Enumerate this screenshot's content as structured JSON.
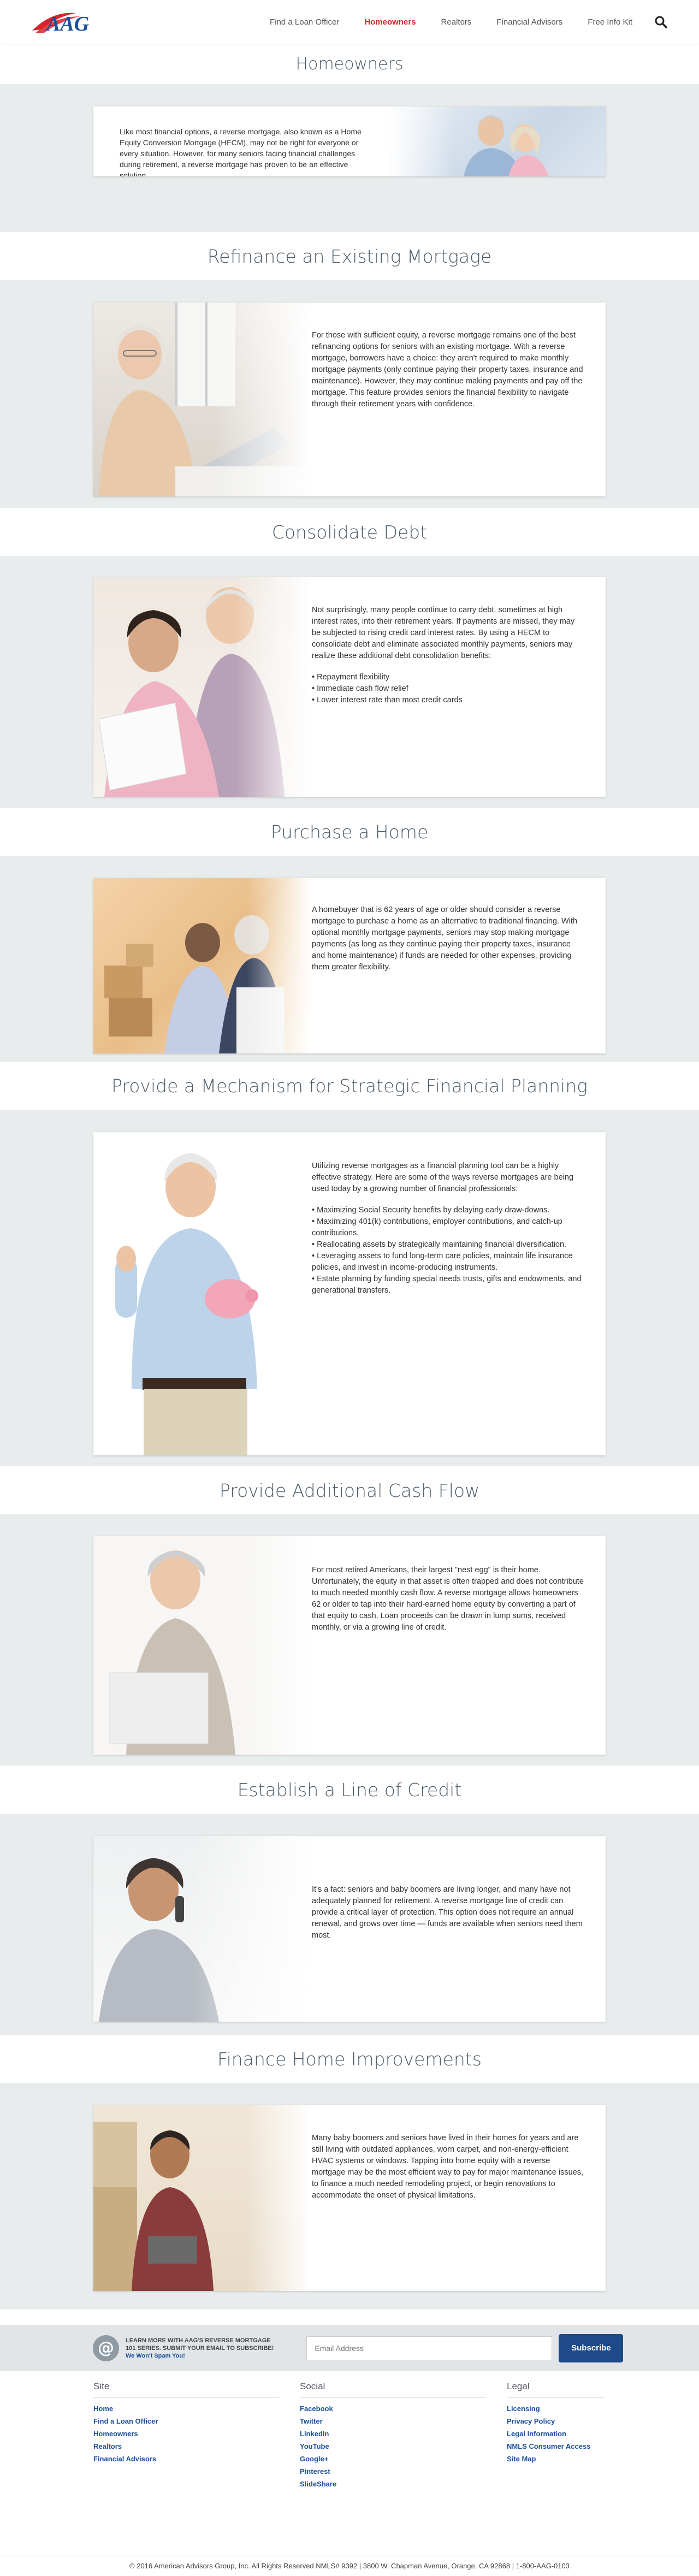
{
  "brand": {
    "logo_text": "AAG",
    "primary": "#1a4f9c",
    "accent": "#d8232a"
  },
  "nav": {
    "items": [
      {
        "label": "Find a Loan Officer"
      },
      {
        "label": "Homeowners"
      },
      {
        "label": "Realtors"
      },
      {
        "label": "Financial Advisors"
      },
      {
        "label": "Free Info Kit"
      }
    ],
    "search_icon": "search-icon"
  },
  "page_title": "Homeowners",
  "intro": {
    "text": "Like most financial options, a reverse mortgage, also known as a Home Equity Conversion Mortgage (HECM), may not be right for everyone or every situation. However, for many seniors facing financial challenges during retirement, a reverse mortgage has proven to be an effective solution."
  },
  "sections": [
    {
      "title": "Refinance an Existing Mortgage",
      "text": "For those with sufficient equity, a reverse mortgage remains one of the best refinancing options for seniors with an existing mortgage. With a reverse mortgage, borrowers have a choice: they aren't required to make monthly mortgage payments (only continue paying their property taxes, insurance and maintenance). However, they may continue making payments and pay off the mortgage. This feature provides seniors the financial flexibility to navigate through their retirement years with confidence."
    },
    {
      "title": "Consolidate Debt",
      "text": "Not surprisingly, many people continue to carry debt, sometimes at high interest rates, into their retirement years. If payments are missed, they may be subjected to rising credit card interest rates. By using a HECM to consolidate debt and eliminate associated monthly payments, seniors may realize these additional debt consolidation benefits:",
      "bullets": [
        "Repayment flexibility",
        "Immediate cash flow relief",
        "Lower interest rate than most credit cards"
      ]
    },
    {
      "title": "Purchase a Home",
      "text": "A homebuyer that is 62 years of age or older should consider a reverse mortgage to purchase a home as an alternative to traditional financing. With optional monthly mortgage payments, seniors may stop making mortgage payments (as long as they continue paying their property taxes, insurance and home maintenance) if funds are needed for other expenses, providing them greater flexibility."
    },
    {
      "title": "Provide a Mechanism for Strategic Financial Planning",
      "text": "Utilizing reverse mortgages as a financial planning tool can be a highly effective strategy. Here are some of the ways reverse mortgages are being used today by a growing number of financial professionals:",
      "bullets": [
        "Maximizing Social Security benefits by delaying early draw-downs.",
        "Maximizing 401(k) contributions, employer contributions, and catch-up contributions.",
        "Reallocating assets by strategically maintaining financial diversification.",
        "Leveraging assets to fund long-term care policies, maintain life insurance policies, and invest in income-producing instruments.",
        "Estate planning by funding special needs trusts, gifts and endowments, and generational transfers."
      ]
    },
    {
      "title": "Provide Additional Cash Flow",
      "text": "For most retired Americans, their largest \"nest egg\" is their home. Unfortunately, the equity in that asset is often trapped and does not contribute to much needed monthly cash flow. A reverse mortgage allows homeowners 62 or older to tap into their hard-earned home equity by converting a part of that equity to cash. Loan proceeds can be drawn in lump sums, received monthly, or via a growing line of credit."
    },
    {
      "title": "Establish a Line of Credit",
      "text": "It's a fact: seniors and baby boomers are living longer, and many have not adequately planned for retirement. A reverse mortgage line of credit can provide a critical layer of protection. This option does not require an annual renewal, and grows over time — funds are available when seniors need them most."
    },
    {
      "title": "Finance Home Improvements",
      "text": "Many baby boomers and seniors have lived in their homes for years and are still living with outdated appliances, worn carpet, and non-energy-efficient HVAC systems or windows. Tapping into home equity with a reverse mortgage may be the most efficient way to pay for major maintenance issues, to finance a much needed remodeling project, or begin renovations to accommodate the onset of physical limitations."
    }
  ],
  "newsletter": {
    "line1": "LEARN MORE WITH AAG'S REVERSE MORTGAGE",
    "line2": "101 SERIES. SUBMIT YOUR EMAIL TO SUBSCRIBE!",
    "line3": "We Won't Spam You!",
    "placeholder": "Email Address",
    "button": "Subscribe"
  },
  "footer": {
    "site": {
      "heading": "Site",
      "links": [
        "Home",
        "Find a Loan Officer",
        "Homeowners",
        "Realtors",
        "Financial Advisors"
      ]
    },
    "social": {
      "heading": "Social",
      "links": [
        "Facebook",
        "Twitter",
        "LinkedIn",
        "YouTube",
        "Google+",
        "Pinterest",
        "SlideShare"
      ]
    },
    "legal": {
      "heading": "Legal",
      "links": [
        "Licensing",
        "Privacy Policy",
        "Legal Information",
        "NMLS Consumer Access",
        "Site Map"
      ]
    },
    "copyright": "© 2016 American Advisors Group, Inc. All Rights Reserved NMLS# 9392 | 3800 W. Chapman Avenue, Orange, CA 92868 | 1-800-AAG-0103"
  }
}
